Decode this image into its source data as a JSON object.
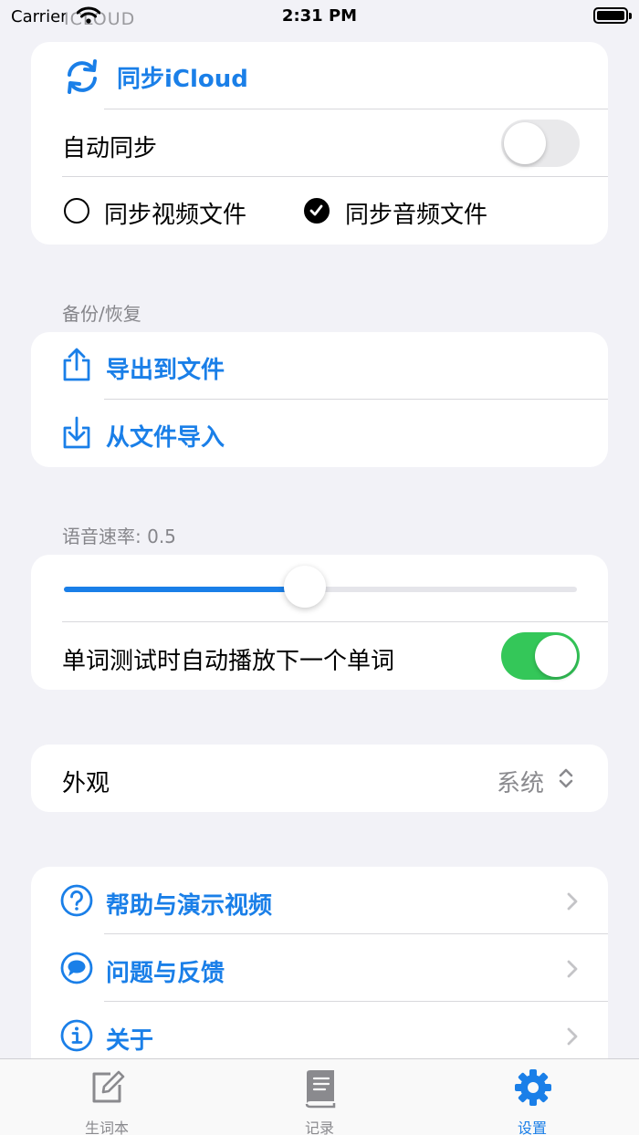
{
  "status_bar": {
    "carrier": "Carrier",
    "time": "2:31 PM",
    "ghost_header": "ICLOUD"
  },
  "icloud": {
    "sync_label": "同步iCloud",
    "auto_sync_label": "自动同步",
    "auto_sync_on": false,
    "sync_video_label": "同步视频文件",
    "sync_video_checked": false,
    "sync_audio_label": "同步音频文件",
    "sync_audio_checked": true
  },
  "backup": {
    "header": "备份/恢复",
    "export_label": "导出到文件",
    "import_label": "从文件导入"
  },
  "speech": {
    "header": "语音速率: 0.5",
    "rate_value": 0.5,
    "auto_play_label": "单词测试时自动播放下一个单词",
    "auto_play_on": true
  },
  "appearance": {
    "label": "外观",
    "value": "系统"
  },
  "links": {
    "help_label": "帮助与演示视频",
    "feedback_label": "问题与反馈",
    "about_label": "关于"
  },
  "tabbar": {
    "tabs": [
      {
        "label": "生词本",
        "icon": "compose-icon"
      },
      {
        "label": "记录",
        "icon": "book-icon"
      },
      {
        "label": "设置",
        "icon": "gear-icon"
      }
    ],
    "active_index": 2
  },
  "colors": {
    "accent": "#1a7fe8",
    "toggle_on": "#34c759",
    "background": "#f2f2f7"
  }
}
